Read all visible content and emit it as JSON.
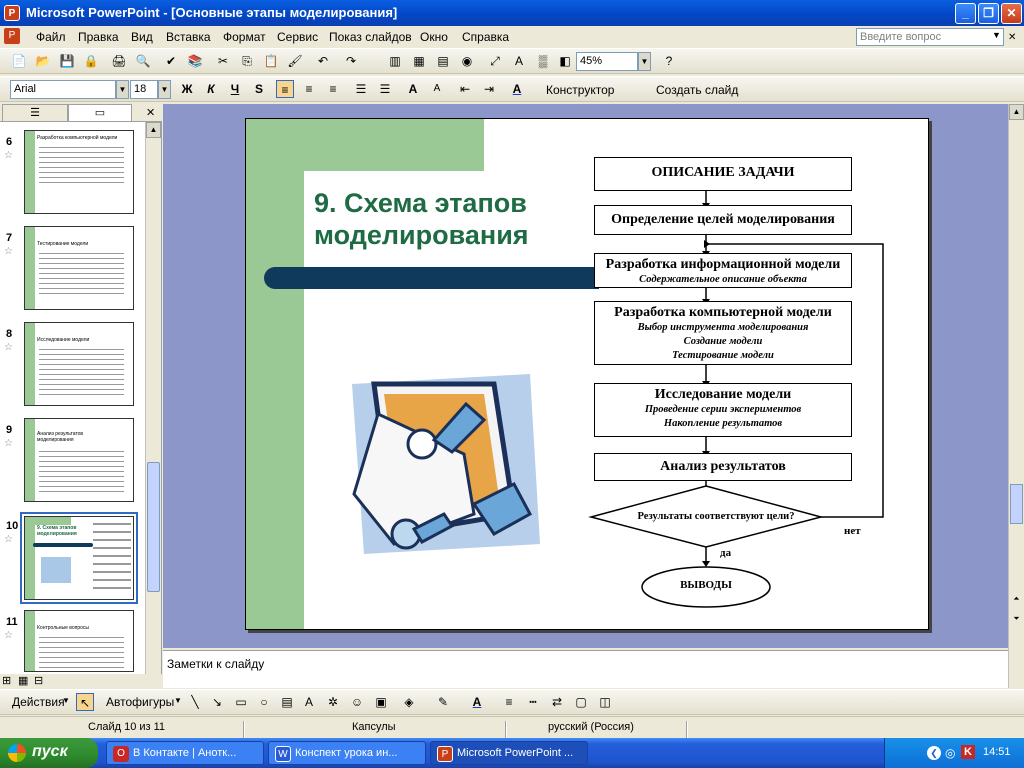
{
  "window": {
    "title": "Microsoft PowerPoint - [Основные этапы моделирования]",
    "app_icon_text": "P"
  },
  "menu": {
    "items": [
      "Файл",
      "Правка",
      "Вид",
      "Вставка",
      "Формат",
      "Сервис",
      "Показ слайдов",
      "Окно",
      "Справка"
    ],
    "ask_placeholder": "Введите вопрос"
  },
  "toolbar": {
    "zoom": "45%"
  },
  "format_toolbar": {
    "font": "Arial",
    "size": "18",
    "bold": "Ж",
    "italic": "К",
    "underline": "Ч",
    "shadow": "S",
    "designer": "Конструктор",
    "new_slide": "Создать слайд"
  },
  "slides_panel": {
    "thumbs": [
      {
        "num": "6",
        "title": "Разработка компьютерной модели"
      },
      {
        "num": "7",
        "title": "Тестирование модели"
      },
      {
        "num": "8",
        "title": "Исследование модели"
      },
      {
        "num": "9",
        "title": "Анализ результатов моделирования"
      },
      {
        "num": "10",
        "title": "9. Схема этапов моделирования"
      },
      {
        "num": "11",
        "title": "Контрольные вопросы"
      }
    ]
  },
  "slide": {
    "title": "9. Схема этапов моделирования",
    "flow": {
      "box1": "ОПИСАНИЕ ЗАДАЧИ",
      "box2": "Определение целей моделирования",
      "box3_h": "Разработка информационной модели",
      "box3_s": "Содержательное описание объекта",
      "box4_h": "Разработка компьютерной модели",
      "box4_s1": "Выбор инструмента моделирования",
      "box4_s2": "Создание модели",
      "box4_s3": "Тестирование модели",
      "box5_h": "Исследование модели",
      "box5_s1": "Проведение серии экспериментов",
      "box5_s2": "Накопление результатов",
      "box6": "Анализ результатов",
      "decision": "Результаты соответствуют цели?",
      "no": "нет",
      "yes": "да",
      "end": "ВЫВОДЫ"
    }
  },
  "notes": {
    "placeholder": "Заметки к слайду"
  },
  "drawbar": {
    "actions": "Действия",
    "autoshapes": "Автофигуры"
  },
  "status": {
    "slide": "Слайд 10 из 11",
    "design": "Капсулы",
    "language": "русский (Россия)"
  },
  "taskbar": {
    "start": "пуск",
    "tasks": [
      "В Контакте | Анотк...",
      "Конспект урока  ин...",
      "Microsoft PowerPoint ..."
    ],
    "lang": "EN",
    "clock": "14:51"
  },
  "colors": {
    "accent_green": "#9bc995",
    "title_green": "#1e6b44",
    "navy": "#0f3a5c",
    "workspace": "#8c96c8"
  }
}
